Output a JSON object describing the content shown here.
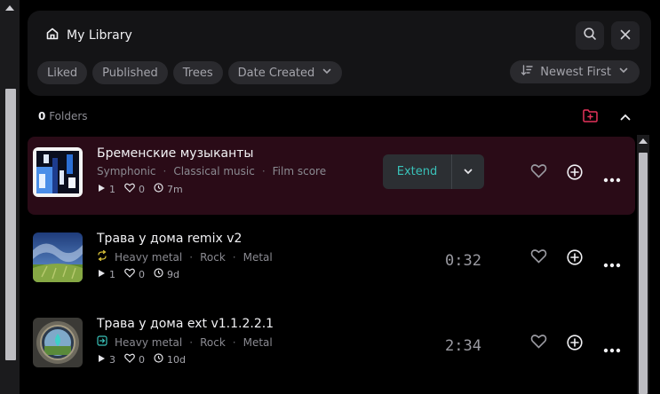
{
  "header": {
    "title": "My Library",
    "filters": [
      "Liked",
      "Published",
      "Trees"
    ],
    "date_filter": "Date Created",
    "sort": "Newest First"
  },
  "folders": {
    "count": "0",
    "label": "Folders"
  },
  "songs": [
    {
      "title": "Бременские музыканты",
      "tags": [
        "Symphonic",
        "Classical music",
        "Film score"
      ],
      "plays": "1",
      "likes": "0",
      "age": "7m",
      "action": "Extend"
    },
    {
      "title": "Трава у дома remix v2",
      "tags": [
        "Heavy metal",
        "Rock",
        "Metal"
      ],
      "plays": "1",
      "likes": "0",
      "age": "9d",
      "duration": "0:32"
    },
    {
      "title": "Трава у дома ext v1.1.2.2.1",
      "tags": [
        "Heavy metal",
        "Rock",
        "Metal"
      ],
      "plays": "3",
      "likes": "0",
      "age": "10d",
      "duration": "2:34"
    }
  ],
  "colors": {
    "accent_teal": "#39c2b9",
    "active_row": "#2a0b17",
    "folder_icon": "#e4325a"
  }
}
